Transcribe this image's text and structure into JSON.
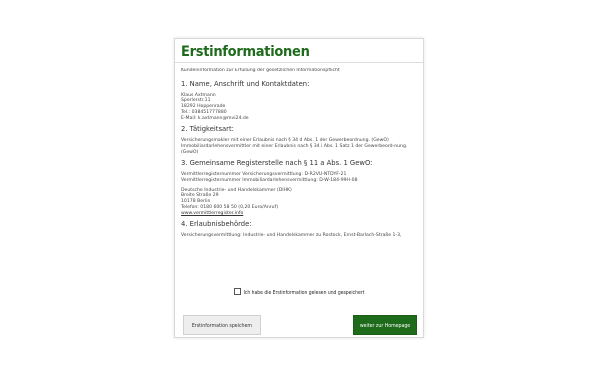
{
  "modal": {
    "title": "Erstinformationen",
    "intro": "Kundeninformation zur Erfüllung der gesetzlichen Informationspflicht",
    "sections": [
      {
        "heading": "1. Name, Anschrift und Kontaktdaten:",
        "lines": [
          "Klaus Axtmann",
          "Sperlerstr.11",
          "18292 Hoppenrade",
          "Tel.: 038451777880",
          "E-Mail: k.axtmann@mvi24.de"
        ]
      },
      {
        "heading": "2. Tätigkeitsart:",
        "lines": [
          "Versicherungsmakler mit einer Erlaubnis nach § 34 d Abs. 1 der Gewerbeordnung. (GewO)",
          "Immobiliardarlehensvermittler mit einer Erlaubnis nach § 34 i Abs. 1 Satz 1 der Gewerbeord-nung. (GewO)"
        ]
      },
      {
        "heading": "3. Gemeinsame Registerstelle nach § 11 a Abs. 1 GewO:",
        "registry_lines": [
          "Vermittlerregisternummer Versicherungsvermittlung: D-R2VU-NTDYF-21",
          "Vermittlerregisternummer Immobiliardarlehensvermittlung: D-W-184-99H-08"
        ],
        "address_lines": [
          "Deutsche Industrie- und Handelskammer (DIHK)",
          "Breite Straße 29",
          "10178 Berlin",
          "Telefon: 0180 600 58 50 (0,20 Euro/Anruf)"
        ],
        "link": "www.vermittlerregister.info"
      },
      {
        "heading": "4. Erlaubnisbehörde:",
        "lines": [
          "Versicherungsvermittlung: Industrie- und Handelskammer zu Rostock, Ernst-Barlach-Straße 1-3,"
        ]
      }
    ],
    "consent_label": "Ich habe die Erstinformation gelesen und gespeichert",
    "consent_checked": false,
    "save_button": "Erstinformation speichern",
    "next_button": "weiter zur Homepage"
  },
  "colors": {
    "accent": "#1e6b1c",
    "save_button_bg": "#eeeeee",
    "border": "#d9d9d9"
  }
}
